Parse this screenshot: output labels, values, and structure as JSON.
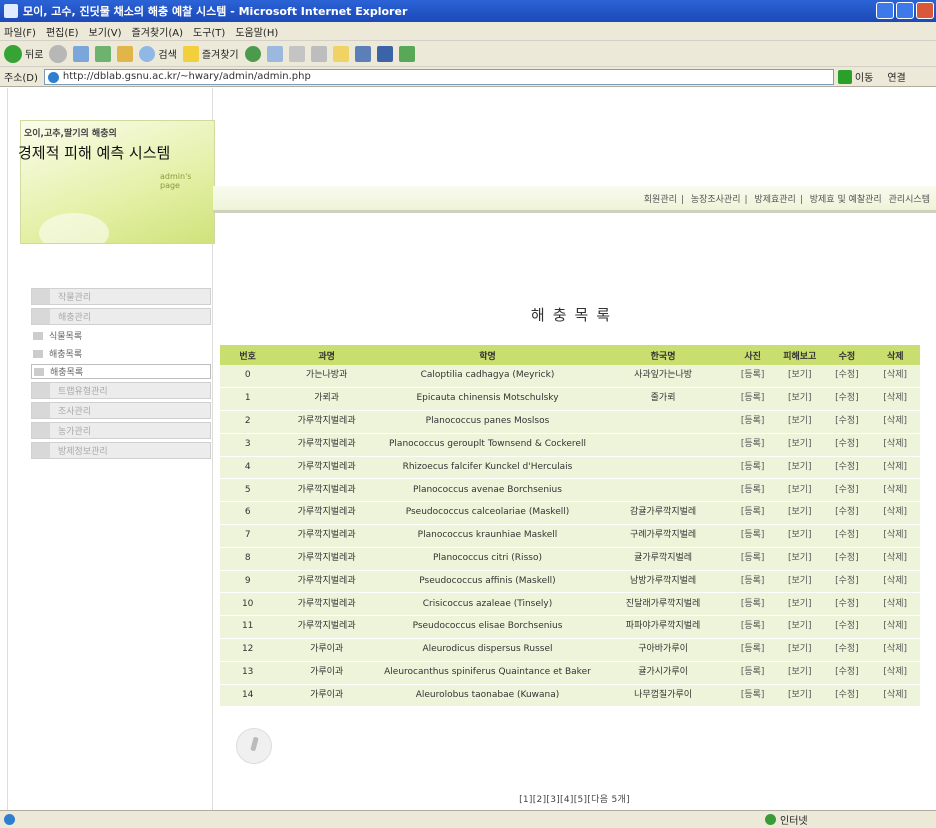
{
  "window": {
    "title": "모이, 고수, 진딧물 채소의 해충 예찰 시스템 - Microsoft Internet Explorer"
  },
  "menubar": [
    "파일(F)",
    "편집(E)",
    "보기(V)",
    "즐겨찾기(A)",
    "도구(T)",
    "도움말(H)"
  ],
  "toolbar": {
    "back": "뒤로",
    "search": "검색",
    "favorites": "즐겨찾기"
  },
  "addressbar": {
    "label": "주소(D)",
    "url": "http://dblab.gsnu.ac.kr/~hwary/admin/admin.php",
    "go": "이동",
    "links": "연결"
  },
  "logo": {
    "small": "오이,고추,딸기의 해충의",
    "title": "경제적 피해 예측 시스템",
    "sub": "admin's page"
  },
  "sidebar": {
    "items": [
      {
        "label": "작물관리",
        "type": "big"
      },
      {
        "label": "해충관리",
        "type": "big"
      },
      {
        "label": "식물목록",
        "type": "small"
      },
      {
        "label": "해충목록",
        "type": "small"
      },
      {
        "label": "해충목록",
        "type": "small",
        "active": true
      },
      {
        "label": "트랩유형관리",
        "type": "big"
      },
      {
        "label": "조사관리",
        "type": "big"
      },
      {
        "label": "농가관리",
        "type": "big"
      },
      {
        "label": "방제정보관리",
        "type": "big"
      }
    ]
  },
  "topnav": {
    "links": [
      "회원관리",
      "농장조사관리",
      "방제효관리",
      "방제효 및 예찰관리",
      "관리시스템"
    ],
    "sep": "|"
  },
  "main": {
    "title": "해충목록"
  },
  "table": {
    "headers": [
      "번호",
      "과명",
      "학명",
      "한국명",
      "사진",
      "피해보고",
      "수정",
      "삭제"
    ],
    "rows": [
      [
        "0",
        "가는나방과",
        "Caloptilia cadhagya (Meyrick)",
        "사과잎가는나방",
        "[등록]",
        "[보기]",
        "[수정]",
        "[삭제]"
      ],
      [
        "1",
        "가뢰과",
        "Epicauta chinensis Motschulsky",
        "줄가뢰",
        "[등록]",
        "[보기]",
        "[수정]",
        "[삭제]"
      ],
      [
        "2",
        "가루깍지벌레과",
        "Planococcus panes Moslsos",
        "",
        "[등록]",
        "[보기]",
        "[수정]",
        "[삭제]"
      ],
      [
        "3",
        "가루깍지벌레과",
        "Planococcus gerouplt Townsend & Cockerell",
        "",
        "[등록]",
        "[보기]",
        "[수정]",
        "[삭제]"
      ],
      [
        "4",
        "가루깍지벌레과",
        "Rhizoecus falcifer Kunckel d'Herculais",
        "",
        "[등록]",
        "[보기]",
        "[수정]",
        "[삭제]"
      ],
      [
        "5",
        "가루깍지벌레과",
        "Planococcus avenae Borchsenius",
        "",
        "[등록]",
        "[보기]",
        "[수정]",
        "[삭제]"
      ],
      [
        "6",
        "가루깍지벌레과",
        "Pseudococcus calceolariae (Maskell)",
        "감귤가루깍지벌레",
        "[등록]",
        "[보기]",
        "[수정]",
        "[삭제]"
      ],
      [
        "7",
        "가루깍지벌레과",
        "Planococcus kraunhiae Maskell",
        "구례가루깍지벌레",
        "[등록]",
        "[보기]",
        "[수정]",
        "[삭제]"
      ],
      [
        "8",
        "가루깍지벌레과",
        "Planococcus citri (Risso)",
        "귤가루깍지벌레",
        "[등록]",
        "[보기]",
        "[수정]",
        "[삭제]"
      ],
      [
        "9",
        "가루깍지벌레과",
        "Pseudococcus affinis (Maskell)",
        "남방가루깍지벌레",
        "[등록]",
        "[보기]",
        "[수정]",
        "[삭제]"
      ],
      [
        "10",
        "가루깍지벌레과",
        "Crisicoccus azaleae (Tinsely)",
        "진달래가루깍지벌레",
        "[등록]",
        "[보기]",
        "[수정]",
        "[삭제]"
      ],
      [
        "11",
        "가루깍지벌레과",
        "Pseudococcus elisae Borchsenius",
        "파파야가루깍지벌레",
        "[등록]",
        "[보기]",
        "[수정]",
        "[삭제]"
      ],
      [
        "12",
        "가루이과",
        "Aleurodicus dispersus Russel",
        "구아바가루이",
        "[등록]",
        "[보기]",
        "[수정]",
        "[삭제]"
      ],
      [
        "13",
        "가루이과",
        "Aleurocanthus spiniferus Quaintance et Baker",
        "귤가시가루이",
        "[등록]",
        "[보기]",
        "[수정]",
        "[삭제]"
      ],
      [
        "14",
        "가루이과",
        "Aleurolobus taonabae (Kuwana)",
        "나무껍질가루이",
        "[등록]",
        "[보기]",
        "[수정]",
        "[삭제]"
      ]
    ]
  },
  "pager": {
    "text": "[1][2][3][4][5][다음 5개]"
  },
  "statusbar": {
    "zone": "인터넷"
  }
}
